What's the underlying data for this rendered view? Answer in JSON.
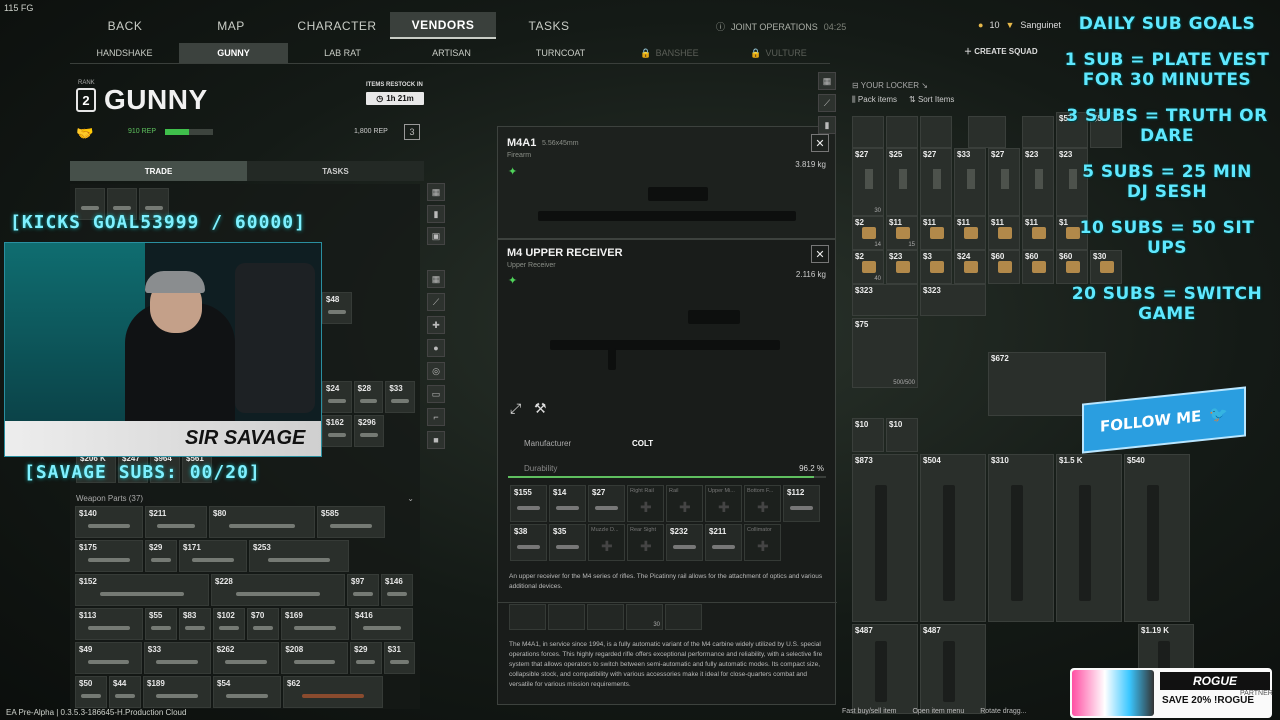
{
  "hud": {
    "fps": "115 FG"
  },
  "topnav": {
    "tabs": [
      "BACK",
      "MAP",
      "CHARACTER",
      "VENDORS",
      "TASKS"
    ],
    "active": "VENDORS",
    "mode": "JOINT OPERATIONS",
    "time": "04:25"
  },
  "subnav": {
    "vendors": [
      "HANDSHAKE",
      "GUNNY",
      "LAB RAT",
      "ARTISAN",
      "TURNCOAT",
      "BANSHEE",
      "VULTURE"
    ]
  },
  "player": {
    "level": "10",
    "name": "Sanguinet",
    "create_squad": "CREATE SQUAD"
  },
  "vendor": {
    "rank_label": "RANK",
    "rank": "2",
    "name": "GUNNY",
    "restock_label": "ITEMS RESTOCK IN",
    "restock_time": "1h 21m",
    "rep_current": "910 REP",
    "rep_goal": "1,800 REP",
    "rep_progress": 0.51,
    "next_rank": "3",
    "tabs": [
      "TRADE",
      "TASKS"
    ]
  },
  "vendor_items": {
    "weapon_parts_title": "Weapon Parts (37)",
    "rows_top": [
      [
        "$48"
      ],
      [
        "$24",
        "$28",
        "$33"
      ],
      [
        "$162",
        "$296"
      ]
    ],
    "rows_parts": [
      [
        "$140",
        "$211",
        "$80",
        "$585"
      ],
      [
        "$175",
        "$29",
        "$171",
        "$253"
      ],
      [
        "$152",
        "$228",
        "$97",
        "$146"
      ],
      [
        "$113",
        "$55",
        "$83",
        "$102",
        "$70",
        "$169",
        "$416"
      ],
      [
        "$49",
        "$33",
        "$262",
        "$208",
        "$29",
        "$31"
      ],
      [
        "$50",
        "$44",
        "$189",
        "$54",
        "$62"
      ]
    ],
    "misc_prices": [
      "$206 K",
      "$247",
      "$964",
      "$561"
    ]
  },
  "popup_primary": {
    "title": "M4A1",
    "caliber": "5.56x45mm",
    "category": "Firearm",
    "weight": "3.819 kg"
  },
  "popup_part": {
    "title": "M4 UPPER RECEIVER",
    "category": "Upper Receiver",
    "weight": "2.116 kg",
    "manufacturer_label": "Manufacturer",
    "manufacturer": "COLT",
    "durability_label": "Durability",
    "durability": "96.2 %",
    "durability_value": 0.962,
    "attachments_row1": [
      {
        "price": "$155"
      },
      {
        "price": "$14"
      },
      {
        "price": "$27"
      },
      {
        "slot": "Right Rail"
      },
      {
        "slot": "Rail"
      },
      {
        "slot": "Upper Mi..."
      },
      {
        "slot": "Bottom F..."
      },
      {
        "price": "$112"
      }
    ],
    "attachments_row2": [
      {
        "price": "$38"
      },
      {
        "price": "$35"
      },
      {
        "slot": "Muzzle D..."
      },
      {
        "slot": "Rear Sight"
      },
      {
        "price": "$232"
      },
      {
        "price": "$211"
      },
      {
        "slot": "Collimator"
      }
    ],
    "description": "An upper receiver for the M4 series of rifles. The Picatinny rail allows for the attachment of optics and various additional devices.",
    "strip_qty": "30",
    "long_description": "The M4A1, in service since 1994, is a fully automatic variant of the M4 carbine widely utilized by U.S. special operations forces. This highly regarded rifle offers exceptional performance and reliability, with a selective fire system that allows operators to switch between semi-automatic and fully automatic modes. Its compact size, collapsible stock, and compatibility with various accessories make it ideal for close-quarters combat and versatile for various mission requirements."
  },
  "locker": {
    "title": "YOUR LOCKER",
    "pack": "Pack items",
    "sort": "Sort Items",
    "row_mags": [
      "$27",
      "$25",
      "$27",
      "$33",
      "$27",
      "$23",
      "$23"
    ],
    "row_top": [
      "$57",
      "$5"
    ],
    "row_ammo1": [
      "$2",
      "$11",
      "$11",
      "$11",
      "$11",
      "$11",
      "$1"
    ],
    "row_ammo2": [
      "$2",
      "$23",
      "$3",
      "$24",
      "$60",
      "$60",
      "$60",
      "$30"
    ],
    "row_mods": [
      "$323",
      "$323"
    ],
    "case_price": "$75",
    "case_qty": "500/500",
    "rifle_price": "$672",
    "grenades": [
      "$10",
      "$10"
    ],
    "rifles_row": [
      "$873",
      "$504",
      "$310",
      "$1.5 K",
      "$540"
    ],
    "rifles_row2": [
      "$487",
      "$487",
      "$1.19 K"
    ],
    "mag_qty": "30",
    "ammo_qty": [
      "14",
      "15",
      "40"
    ]
  },
  "overlay": {
    "kicks_goal": "[KICKS GOAL53999 / 60000]",
    "savage_subs": "[SAVAGE SUBS: 00/20]",
    "streamer_name": "SIR SAVAGE",
    "goals": [
      "DAILY SUB GOALS",
      "1 SUB = PLATE VEST",
      "FOR 30 MINUTES",
      "3 SUBS = TRUTH OR",
      "DARE",
      "5 SUBS = 25 MIN",
      "DJ SESH",
      "10 SUBS = 50 SIT UPS",
      "20 SUBS = SWITCH",
      "GAME"
    ],
    "follow": "FOLLOW ME",
    "promo_brand": "ROGUE",
    "promo_partner": "PARTNER",
    "promo_text": "SAVE 20% !ROGUE"
  },
  "footer": {
    "build": "EA Pre-Alpha | 0.3.5.3-186645-H.Production Cloud",
    "hints": [
      "Fast buy/sell item",
      "Open item menu",
      "Rotate dragg..."
    ]
  }
}
